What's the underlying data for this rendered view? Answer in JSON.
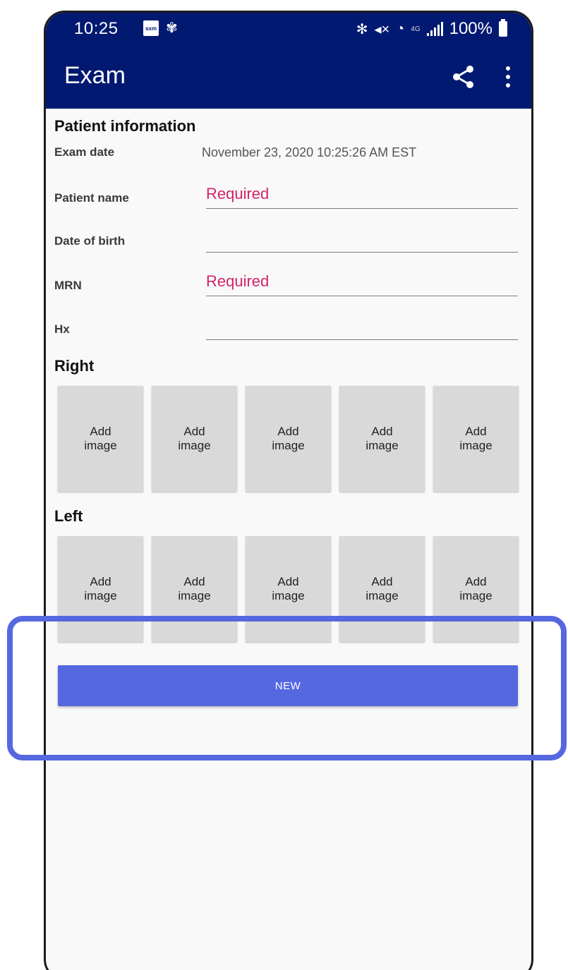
{
  "status_bar": {
    "time": "10:25",
    "network": "4G",
    "battery_text": "100%"
  },
  "app_bar": {
    "title": "Exam",
    "share_icon": "share-icon",
    "more_icon": "more-vert-icon"
  },
  "patient_info": {
    "section_title": "Patient information",
    "exam_date_label": "Exam date",
    "exam_date_value": "November 23, 2020 10:25:26 AM EST",
    "patient_name_label": "Patient name",
    "patient_name_placeholder": "Required",
    "dob_label": "Date of birth",
    "dob_placeholder": "",
    "mrn_label": "MRN",
    "mrn_placeholder": "Required",
    "hx_label": "Hx",
    "hx_placeholder": ""
  },
  "right": {
    "title": "Right",
    "tiles": [
      "Add image",
      "Add image",
      "Add image",
      "Add image",
      "Add image"
    ]
  },
  "left": {
    "title": "Left",
    "tiles": [
      "Add image",
      "Add image",
      "Add image",
      "Add image",
      "Add image"
    ]
  },
  "actions": {
    "new_label": "NEW"
  },
  "colors": {
    "app_bar": "#011971",
    "accent": "#5568e0",
    "required": "#d0256b",
    "tile": "#d9d9d9"
  }
}
